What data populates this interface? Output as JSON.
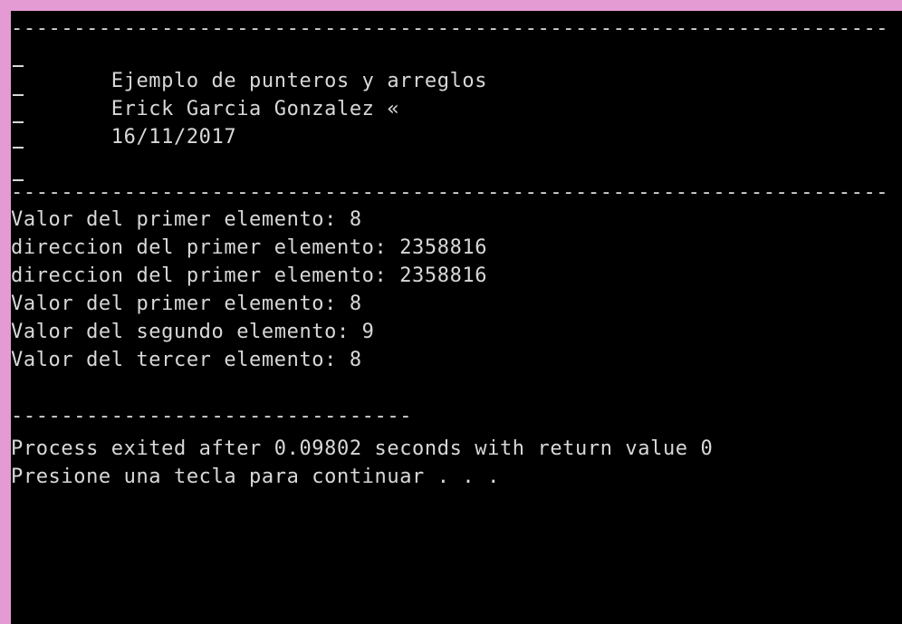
{
  "console": {
    "border_color": "#e49ad3",
    "background": "#000000",
    "text_color": "#d8d8d8",
    "lines": {
      "separator_top": "----------------------------------------------------------------------",
      "header_title": "        Ejemplo de punteros y arreglos",
      "header_author": "        Erick Garcia Gonzalez «",
      "header_date": "        16/11/2017",
      "separator_bottom": "----------------------------------------------------------------------",
      "output_1": "Valor del primer elemento: 8",
      "output_2": "direccion del primer elemento: 2358816",
      "output_3": "direccion del primer elemento: 2358816",
      "output_4": "Valor del primer elemento: 8",
      "output_5": "Valor del segundo elemento: 9",
      "output_6": "Valor del tercer elemento: 8",
      "separator_exit": "--------------------------------",
      "exit_message": "Process exited after 0.09802 seconds with return value 0",
      "prompt": "Presione una tecla para continuar . . ."
    }
  }
}
